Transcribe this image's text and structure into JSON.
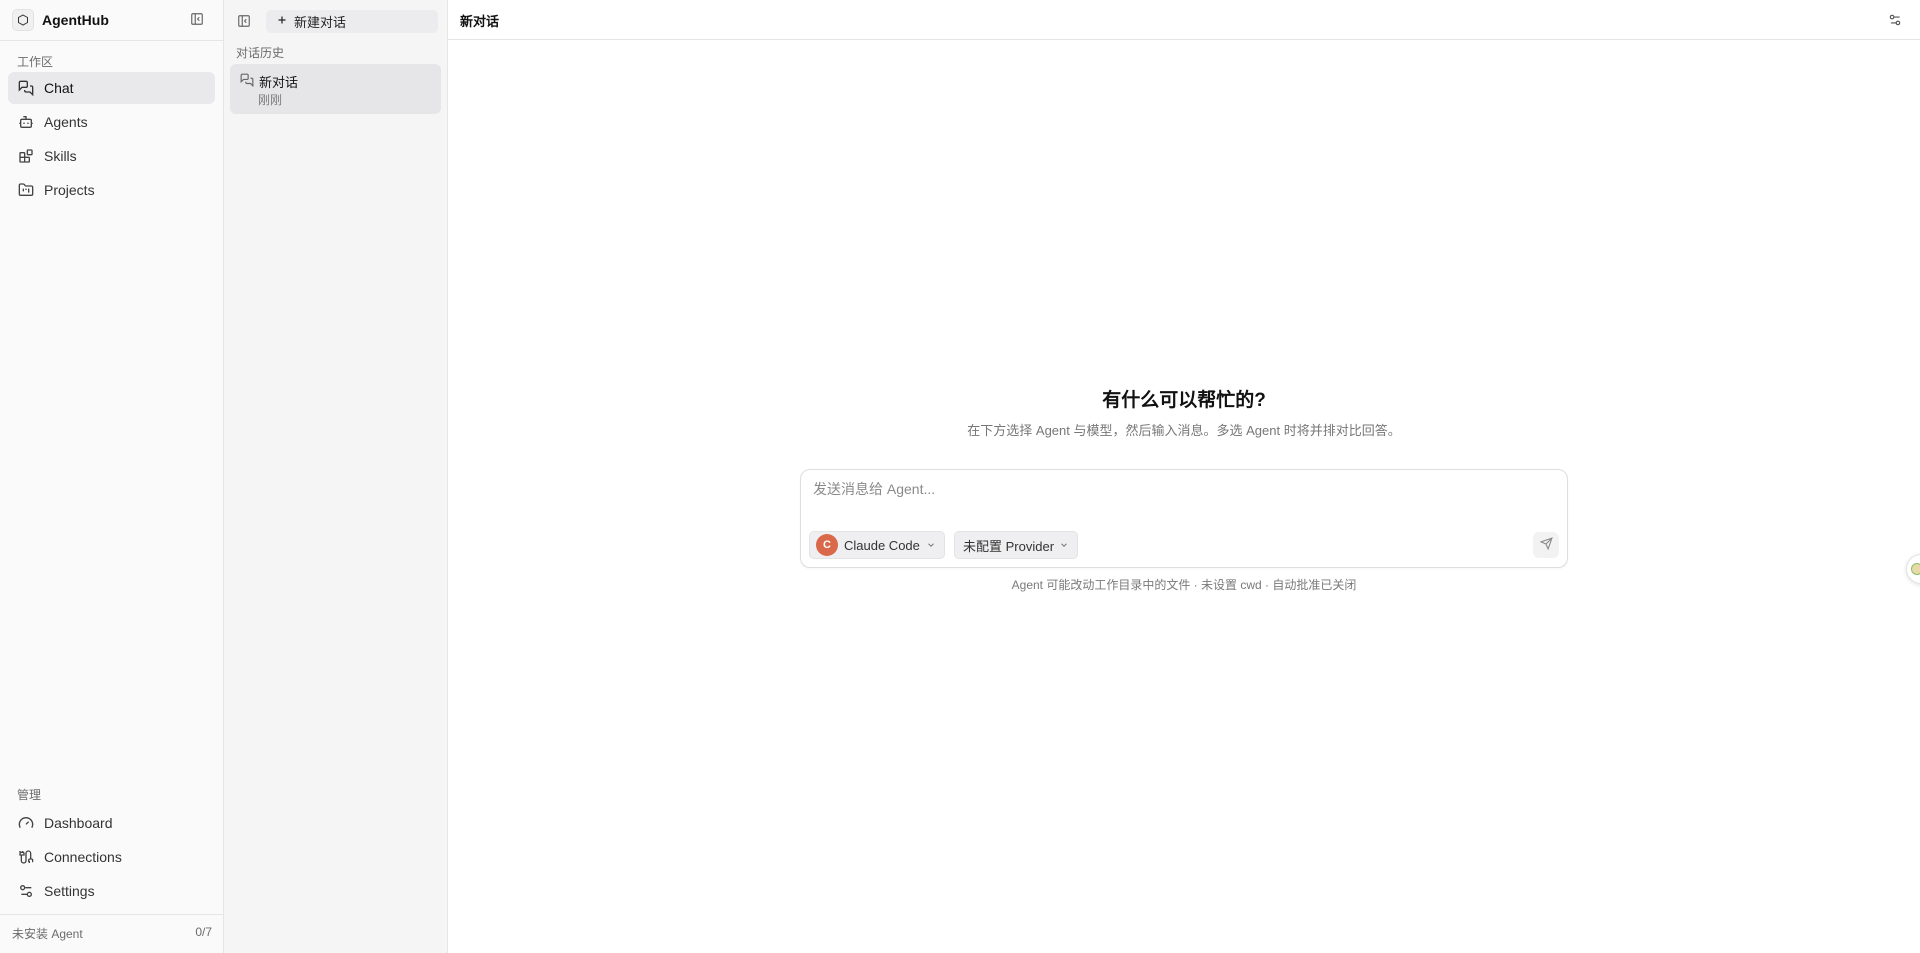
{
  "app": {
    "name": "AgentHub"
  },
  "sidebar": {
    "workspace_label": "工作区",
    "items": [
      {
        "label": "Chat",
        "icon": "chat-icon",
        "active": true
      },
      {
        "label": "Agents",
        "icon": "bot-icon"
      },
      {
        "label": "Skills",
        "icon": "blocks-icon"
      },
      {
        "label": "Projects",
        "icon": "folder-kanban-icon"
      }
    ],
    "manage_label": "管理",
    "manage_items": [
      {
        "label": "Dashboard",
        "icon": "gauge-icon"
      },
      {
        "label": "Connections",
        "icon": "cable-icon"
      },
      {
        "label": "Settings",
        "icon": "sliders-icon"
      }
    ],
    "footer": {
      "status": "未安装 Agent",
      "count": "0/7"
    }
  },
  "history": {
    "new_chat_label": "新建对话",
    "section_label": "对话历史",
    "items": [
      {
        "title": "新对话",
        "time": "刚刚"
      }
    ]
  },
  "main": {
    "title": "新对话",
    "hero_title": "有什么可以帮忙的?",
    "hero_subtitle": "在下方选择 Agent 与模型，然后输入消息。多选 Agent 时将并排对比回答。",
    "composer": {
      "placeholder": "发送消息给 Agent...",
      "agent_initial": "C",
      "agent_label": "Claude Code",
      "provider_label": "未配置 Provider"
    },
    "note": "Agent 可能改动工作目录中的文件 · 未设置 cwd · 自动批准已关闭"
  },
  "colors": {
    "agent_avatar": "#d9694a",
    "active_nav": "#e9e9eb"
  }
}
